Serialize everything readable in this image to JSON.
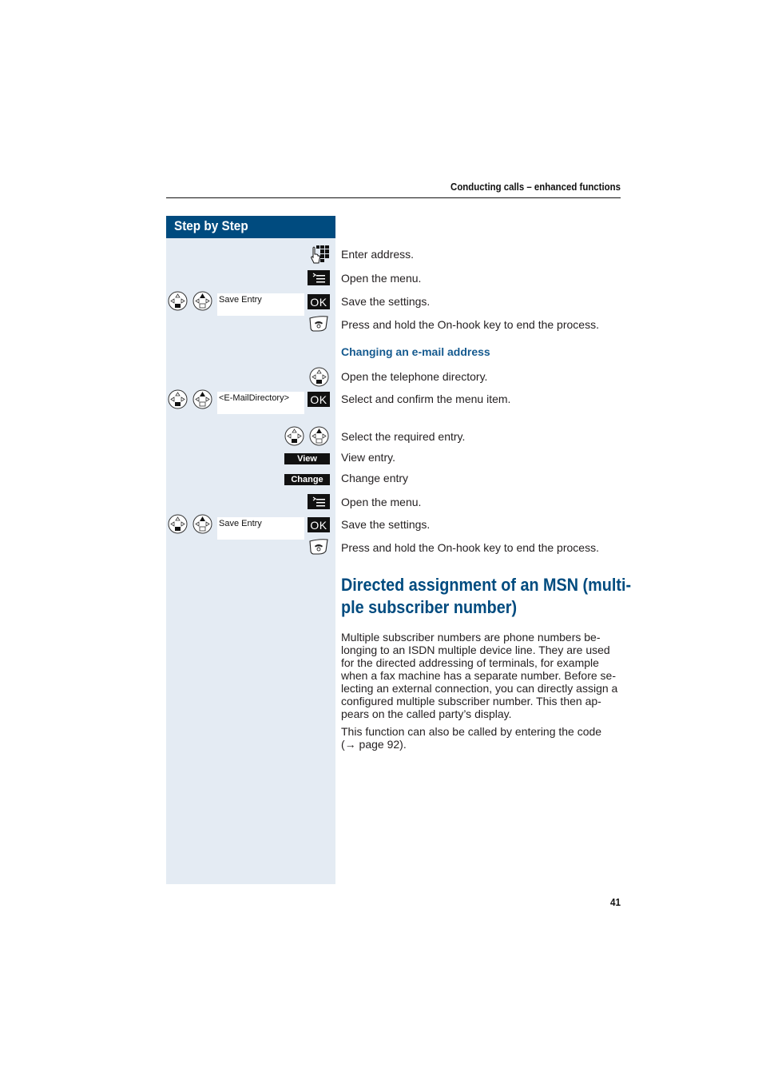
{
  "header": {
    "running_title": "Conducting calls – enhanced functions"
  },
  "sidebar": {
    "title": "Step by Step"
  },
  "steps_section1": [
    {
      "icon": "keypad-icon",
      "text": "Enter address."
    },
    {
      "icon": "menu-key-icon",
      "text": "Open the menu."
    },
    {
      "icon": "ok-key",
      "display": "Save Entry",
      "key_label": "OK",
      "text": "Save the settings."
    },
    {
      "icon": "on-hook-key-icon",
      "text": "Press and hold the On-hook key to end the process."
    }
  ],
  "subheading": "Changing an e-mail address",
  "steps_section2": [
    {
      "icon": "control-key-icon",
      "text": "Open the telephone directory."
    },
    {
      "icon": "ok-key",
      "display": "<E-MailDirectory>",
      "key_label": "OK",
      "text": "Select and confirm the menu item."
    },
    {
      "icon": "control-keys-icon",
      "text": "Select the required entry."
    },
    {
      "icon": "soft-key",
      "key_label": "View",
      "text": "View entry."
    },
    {
      "icon": "soft-key",
      "key_label": "Change",
      "text": "Change entry"
    },
    {
      "icon": "menu-key-icon",
      "text": "Open the menu."
    },
    {
      "icon": "ok-key",
      "display": "Save Entry",
      "key_label": "OK",
      "text": "Save the settings."
    },
    {
      "icon": "on-hook-key-icon",
      "text": "Press and hold the On-hook key to end the process."
    }
  ],
  "section_heading": {
    "line1": "Directed assignment of an MSN (multi-",
    "line2": "ple subscriber number)"
  },
  "paragraphs": [
    "Multiple subscriber numbers are phone numbers be-longing to an ISDN multiple device line. They are used for the directed addressing of terminals, for example when a fax machine has a separate number. Before se-lecting an external connection, you can directly assign a configured multiple subscriber number. This then ap-pears on the called party’s display.",
    "This function can also be called by entering the code (→ page 92)."
  ],
  "paragraph_lines": [
    [
      "Multiple subscriber numbers are phone numbers be-",
      "longing to an ISDN multiple device line. They are used",
      "for the directed addressing of terminals, for example",
      "when a fax machine has a separate number. Before se-",
      "lecting an external connection, you can directly assign a",
      "configured multiple subscriber number. This then ap-",
      "pears on the called party’s display."
    ],
    [
      "This function can also be called by entering the code",
      "(→ page 92)."
    ]
  ],
  "footer": {
    "page_number": "41"
  },
  "colors": {
    "brand_blue": "#004b7f",
    "subhead_blue": "#155a8f",
    "sidebar_bg": "#e4ebf3"
  }
}
